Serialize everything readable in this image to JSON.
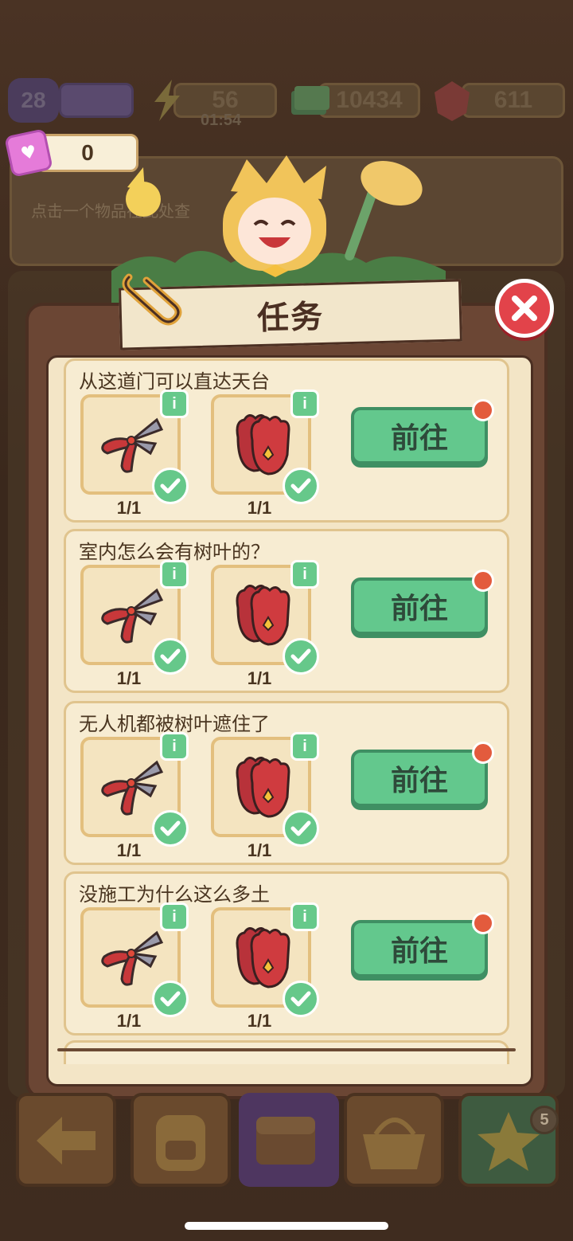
{
  "hud": {
    "level": "28",
    "energy": "56",
    "energy_timer": "01:54",
    "cash": "10434",
    "gems": "611",
    "tickets": "0"
  },
  "hint": {
    "text": "点击一个物品在此处查"
  },
  "modal": {
    "title": "任务",
    "go_label": "前往",
    "tasks": [
      {
        "title": "从这道门可以直达天台",
        "items": [
          {
            "name": "pruning-shears",
            "count": "1/1"
          },
          {
            "name": "gloves",
            "count": "1/1"
          }
        ]
      },
      {
        "title": "室内怎么会有树叶的？",
        "items": [
          {
            "name": "pruning-shears",
            "count": "1/1"
          },
          {
            "name": "gloves",
            "count": "1/1"
          }
        ]
      },
      {
        "title": "无人机都被树叶遮住了",
        "items": [
          {
            "name": "pruning-shears",
            "count": "1/1"
          },
          {
            "name": "gloves",
            "count": "1/1"
          }
        ]
      },
      {
        "title": "没施工为什么这么多土",
        "items": [
          {
            "name": "pruning-shears",
            "count": "1/1"
          },
          {
            "name": "gloves",
            "count": "1/1"
          }
        ]
      }
    ]
  },
  "bottom": {
    "star_count": "5"
  },
  "colors": {
    "accent_green": "#63c88d",
    "close_red": "#e2434a",
    "panel_brown": "#6b4634",
    "paper": "#f3e5c6"
  }
}
